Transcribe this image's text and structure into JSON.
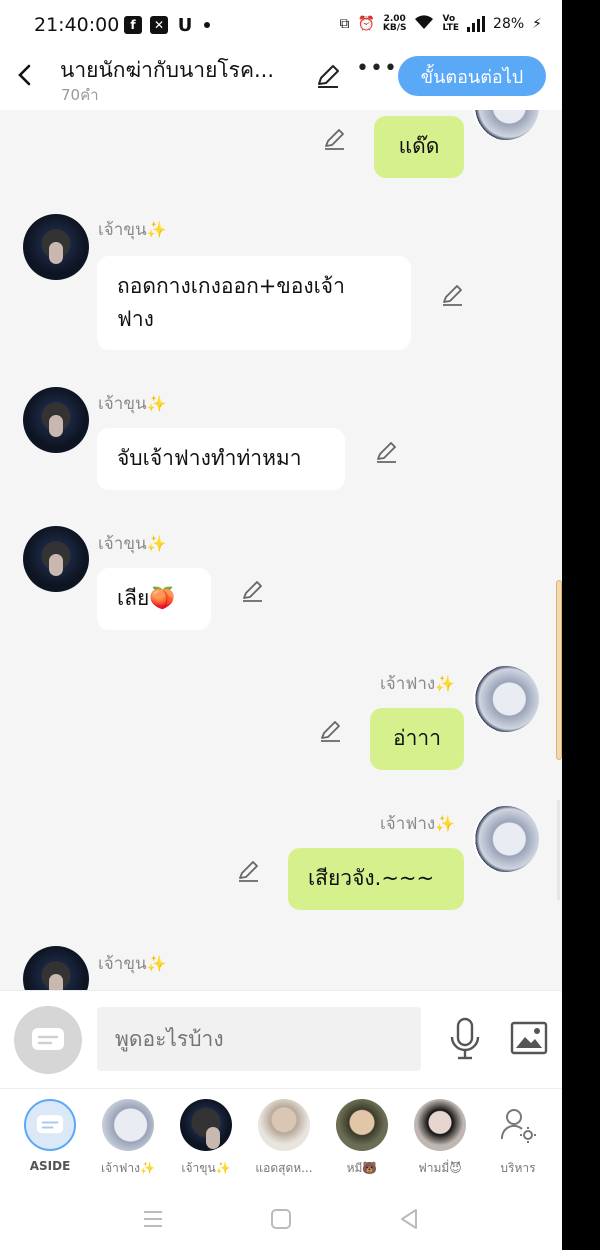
{
  "status_bar": {
    "time": "21:40:00",
    "net_speed_top": "2.00",
    "net_speed_bottom": "KB/S",
    "battery": "28%"
  },
  "header": {
    "title": "นายนักฆ่ากับนายโรค...",
    "word_count": "70คำ",
    "next_button": "ขั้นตอนต่อไป"
  },
  "messages": [
    {
      "side": "right",
      "text": "แด๊ด",
      "bubble_color": "#d6f08d"
    },
    {
      "side": "left",
      "sender": "เจ้าขุน",
      "text_line1": "ถอดกางเกงออก+ของเจ้า",
      "text_line2": "ฟาง"
    },
    {
      "side": "left",
      "sender": "เจ้าขุน",
      "text": "จับเจ้าฟางทำท่าหมา"
    },
    {
      "side": "left",
      "sender": "เจ้าขุน",
      "text": "เลีย🍑"
    },
    {
      "side": "right",
      "sender": "เจ้าฟาง",
      "text": "อ่าาา"
    },
    {
      "side": "right",
      "sender": "เจ้าฟาง",
      "text": "เสียวจัง.~~~"
    },
    {
      "side": "left",
      "sender": "เจ้าขุน"
    }
  ],
  "input": {
    "placeholder": "พูดอะไรบ้าง"
  },
  "characters": [
    {
      "label": "ASIDE"
    },
    {
      "label": "เจ้าฟาง✨"
    },
    {
      "label": "เจ้าขุน✨"
    },
    {
      "label": "แอดสุดห..."
    },
    {
      "label": "หมี🐻"
    },
    {
      "label": "ฟามมี่😈"
    },
    {
      "label": "บริหาร"
    }
  ],
  "colors": {
    "accent": "#5aa9f7",
    "self_bubble": "#d6f08d",
    "other_bubble": "#ffffff",
    "sparkle": "#f3c22a"
  }
}
